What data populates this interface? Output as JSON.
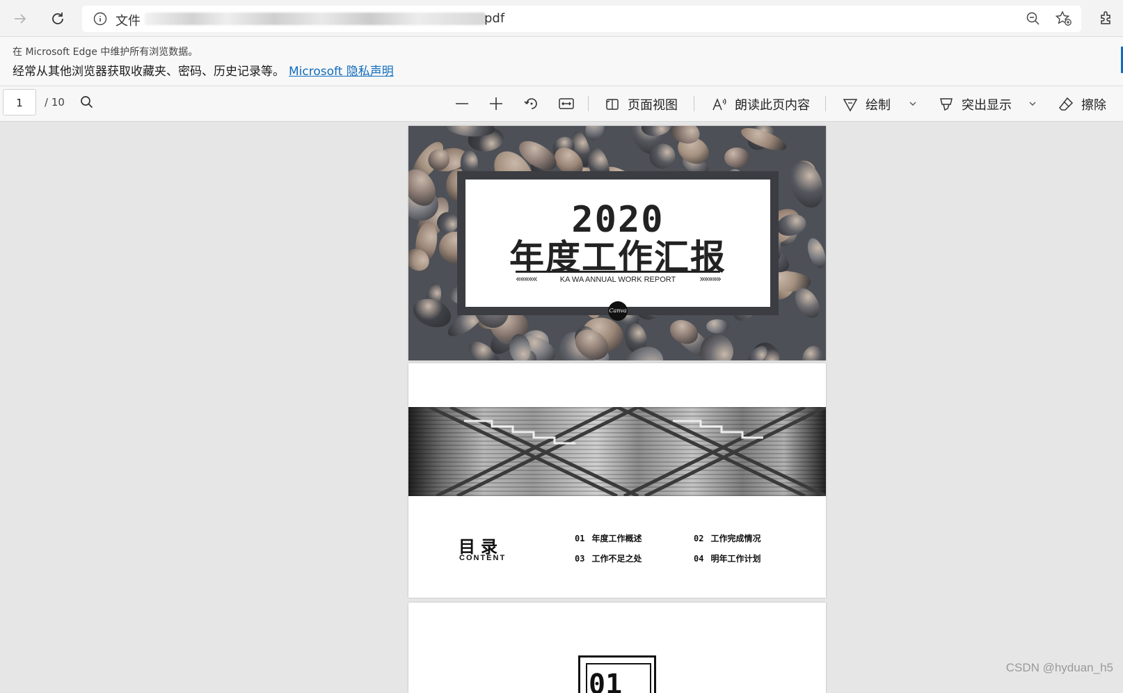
{
  "browser": {
    "address": {
      "scheme_label": "文件",
      "url_suffix": "pdf"
    }
  },
  "banner": {
    "line1": "在 Microsoft Edge 中维护所有浏览数据。",
    "line2": "经常从其他浏览器获取收藏夹、密码、历史记录等。",
    "link": "Microsoft 隐私声明"
  },
  "pdf_toolbar": {
    "page_current": "1",
    "page_total": "/ 10",
    "page_view_label": "页面视图",
    "read_aloud_label": "朗读此页内容",
    "draw_label": "绘制",
    "highlight_label": "突出显示",
    "erase_label": "擦除"
  },
  "pages": {
    "cover": {
      "year": "2020",
      "title": "年度工作汇报",
      "subtitle": "KA WA ANNUAL WORK REPORT",
      "arrows_left": "«««««",
      "arrows_right": "»»»»»",
      "logo": "Canva"
    },
    "toc": {
      "title": "目录",
      "subtitle": "CONTENT",
      "items": [
        {
          "num": "01",
          "text": "年度工作概述"
        },
        {
          "num": "02",
          "text": "工作完成情况"
        },
        {
          "num": "03",
          "text": "工作不足之处"
        },
        {
          "num": "04",
          "text": "明年工作计划"
        }
      ]
    },
    "section": {
      "num": "01"
    }
  },
  "watermark": "CSDN @hyduan_h5",
  "colors": {
    "accent": "#0f6cbd",
    "viewer_background": "#e6e6e6",
    "card_border": "#3b3d42"
  }
}
